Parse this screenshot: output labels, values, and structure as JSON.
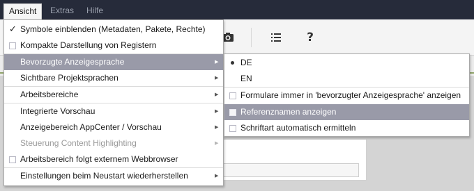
{
  "menubar": {
    "items": [
      "Ansicht",
      "Extras",
      "Hilfe"
    ]
  },
  "toolbar": {
    "icons": [
      "eye-icon",
      "list-icon",
      "help-icon"
    ],
    "help_glyph": "?"
  },
  "background": {
    "edge_char": "i"
  },
  "main_menu": {
    "items": [
      {
        "label": "Symbole einblenden (Metadaten, Pakete, Rechte)",
        "kind": "tick"
      },
      {
        "label": "Kompakte Darstellung von Registern",
        "kind": "checkbox"
      },
      {
        "label": "Bevorzugte Anzeigesprache",
        "kind": "submenu",
        "highlighted": true
      },
      {
        "label": "Sichtbare Projektsprachen",
        "kind": "submenu"
      },
      {
        "label": "Arbeitsbereiche",
        "kind": "submenu"
      },
      {
        "label": "Integrierte Vorschau",
        "kind": "submenu"
      },
      {
        "label": "Anzeigebereich AppCenter / Vorschau",
        "kind": "submenu"
      },
      {
        "label": "Steuerung Content Highlighting",
        "kind": "submenu",
        "disabled": true
      },
      {
        "label": "Arbeitsbereich folgt externem Webbrowser",
        "kind": "checkbox"
      },
      {
        "label": "Einstellungen beim Neustart wiederherstellen",
        "kind": "submenu"
      }
    ]
  },
  "sub_menu": {
    "items": [
      {
        "label": "DE",
        "kind": "radio",
        "selected": true
      },
      {
        "label": "EN",
        "kind": "radio",
        "selected": false
      },
      {
        "label": "Formulare immer in 'bevorzugter Anzeigesprache' anzeigen",
        "kind": "checkbox"
      },
      {
        "label": "Referenznamen anzeigen",
        "kind": "checkbox",
        "highlighted": true
      },
      {
        "label": "Schriftart automatisch ermitteln",
        "kind": "checkbox"
      }
    ]
  },
  "colors": {
    "menubar_bg": "#262b3a",
    "highlight_bg": "#999aa8",
    "accent_green": "#8fa368"
  }
}
